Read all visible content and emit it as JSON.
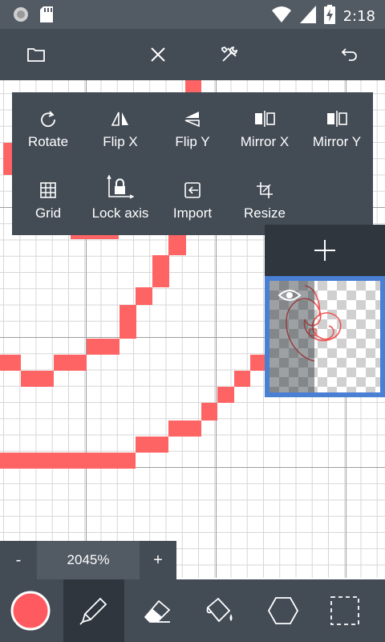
{
  "status_bar": {
    "time": "2:18",
    "icons": [
      "circle-notification-icon",
      "sd-card-icon",
      "wifi-icon",
      "cellular-signal-icon",
      "battery-charging-icon"
    ]
  },
  "toolbar": {
    "icons": [
      "folder-icon",
      "close-icon",
      "tools-icon",
      "undo-icon"
    ]
  },
  "transform_menu": {
    "row1": [
      {
        "label": "Rotate",
        "icon": "rotate-icon"
      },
      {
        "label": "Flip X",
        "icon": "flip-x-icon"
      },
      {
        "label": "Flip Y",
        "icon": "flip-y-icon"
      },
      {
        "label": "Mirror X",
        "icon": "mirror-x-icon"
      },
      {
        "label": "Mirror Y",
        "icon": "mirror-y-icon"
      }
    ],
    "row2": [
      {
        "label": "Grid",
        "icon": "grid-icon"
      },
      {
        "label": "Lock axis",
        "icon": "lock-axis-icon"
      },
      {
        "label": "Import",
        "icon": "import-icon"
      },
      {
        "label": "Resize",
        "icon": "resize-icon"
      }
    ]
  },
  "layers": {
    "add_icon": "plus-icon",
    "visibility_icon": "eye-icon"
  },
  "zoom": {
    "minus_label": "-",
    "value": "2045%",
    "plus_label": "+"
  },
  "tools": {
    "items": [
      "color-swatch",
      "pencil-icon",
      "eraser-icon",
      "paint-bucket-icon",
      "hexagon-shape-icon",
      "selection-icon"
    ],
    "current_color": "#ff5a5f",
    "active": "pencil-icon"
  },
  "colors": {
    "bar_bg": "#434b55",
    "status_bg": "#525a64",
    "pixel_color": "#ff6464",
    "accent": "#4a80d4"
  }
}
